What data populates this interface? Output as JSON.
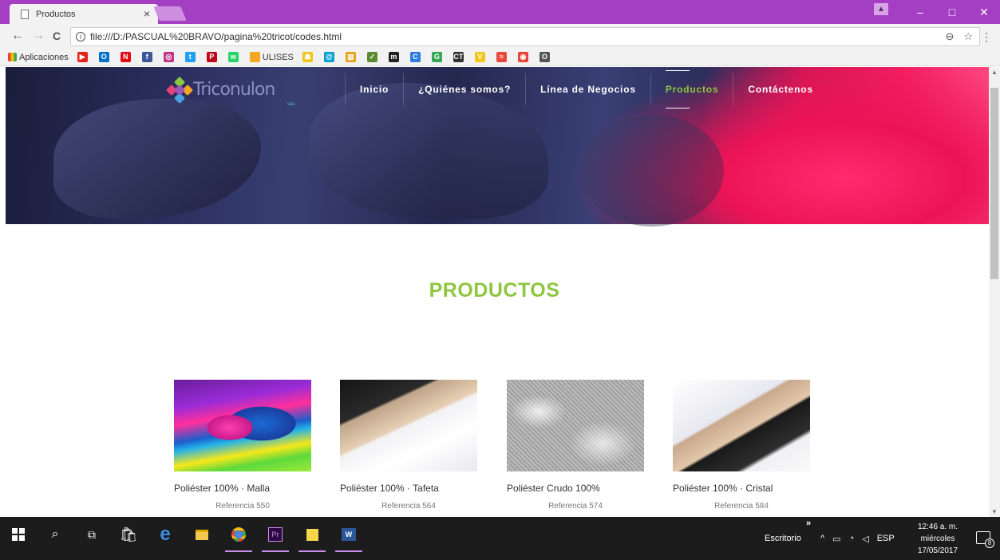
{
  "browser": {
    "tab_title": "Productos",
    "tab_close": "×",
    "url": "file:///D:/PASCUAL%20BRAVO/pagina%20tricot/codes.html",
    "back_glyph": "←",
    "forward_glyph": "→",
    "reload_glyph": "C",
    "info_glyph": "i",
    "zoom_glyph": "⊖",
    "star_glyph": "☆",
    "menu_glyph": "⋮",
    "window_min": "–",
    "window_max": "□",
    "window_close": "✕",
    "profile_glyph": "▲"
  },
  "bookmarks": {
    "apps_label": "Aplicaciones",
    "items": [
      {
        "icon": "youtube-icon",
        "color": "#e62117",
        "glyph": "▶",
        "label": ""
      },
      {
        "icon": "outlook-icon",
        "color": "#0072c6",
        "glyph": "O",
        "label": ""
      },
      {
        "icon": "netflix-icon",
        "color": "#e50914",
        "glyph": "N",
        "label": ""
      },
      {
        "icon": "facebook-icon",
        "color": "#3b5998",
        "glyph": "f",
        "label": ""
      },
      {
        "icon": "instagram-icon",
        "color": "#c13584",
        "glyph": "◎",
        "label": ""
      },
      {
        "icon": "twitter-icon",
        "color": "#1da1f2",
        "glyph": "t",
        "label": ""
      },
      {
        "icon": "pinterest-icon",
        "color": "#bd081c",
        "glyph": "P",
        "label": ""
      },
      {
        "icon": "whatsapp-icon",
        "color": "#25d366",
        "glyph": "w",
        "label": ""
      },
      {
        "icon": "ulises-icon",
        "color": "#f5a623",
        "glyph": "",
        "label": "ULISES"
      },
      {
        "icon": "tv-icon",
        "color": "#f0c419",
        "glyph": "☗",
        "label": ""
      },
      {
        "icon": "mail-icon",
        "color": "#00a0d2",
        "glyph": "@",
        "label": ""
      },
      {
        "icon": "bars-icon",
        "color": "#e6a117",
        "glyph": "▥",
        "label": ""
      },
      {
        "icon": "check-icon",
        "color": "#5c8a2e",
        "glyph": "✓",
        "label": ""
      },
      {
        "icon": "m-icon",
        "color": "#222222",
        "glyph": "m",
        "label": ""
      },
      {
        "icon": "c-icon",
        "color": "#2d7ce0",
        "glyph": "C",
        "label": ""
      },
      {
        "icon": "google-icon",
        "color": "#34a853",
        "glyph": "G",
        "label": ""
      },
      {
        "icon": "ct-icon",
        "color": "#333333",
        "glyph": "CT",
        "label": ""
      },
      {
        "icon": "v-icon",
        "color": "#f5c518",
        "glyph": "V",
        "label": ""
      },
      {
        "icon": "flag-icon",
        "color": "#e8483b",
        "glyph": "≈",
        "label": ""
      },
      {
        "icon": "target-icon",
        "color": "#ea4335",
        "glyph": "◉",
        "label": ""
      },
      {
        "icon": "o-icon",
        "color": "#555555",
        "glyph": "O",
        "label": ""
      }
    ]
  },
  "site": {
    "brand": "Triconulon",
    "brand_suffix": "sas",
    "nav": [
      {
        "label": "Inicio",
        "active": false
      },
      {
        "label": "¿Quiénes somos?",
        "active": false
      },
      {
        "label": "Línea de Negocios",
        "active": false
      },
      {
        "label": "Productos",
        "active": true
      },
      {
        "label": "Contáctenos",
        "active": false
      }
    ],
    "page_title": "PRODUCTOS",
    "accent_color": "#8dc63f",
    "products": [
      {
        "name": "Poliéster 100% · Malla",
        "ref": "Referencia 550",
        "image": "malla"
      },
      {
        "name": "Poliéster 100% · Tafeta",
        "ref": "Referencia 564",
        "image": "tafeta"
      },
      {
        "name": "Poliéster Crudo 100%",
        "ref": "Referencia 574",
        "image": "tulle"
      },
      {
        "name": "Poliéster 100% · Cristal",
        "ref": "Referencia 584",
        "image": "cristal"
      }
    ]
  },
  "taskbar": {
    "desktop_label": "Escritorio",
    "desktop_chevron": "»",
    "language": "ESP",
    "time": "12:46 a. m.",
    "day": "miércoles",
    "date": "17/05/2017",
    "notification_count": "8",
    "apps": [
      "start",
      "search",
      "task-view",
      "store",
      "edge",
      "file-explorer",
      "chrome",
      "premiere",
      "sticky-notes",
      "word"
    ]
  }
}
